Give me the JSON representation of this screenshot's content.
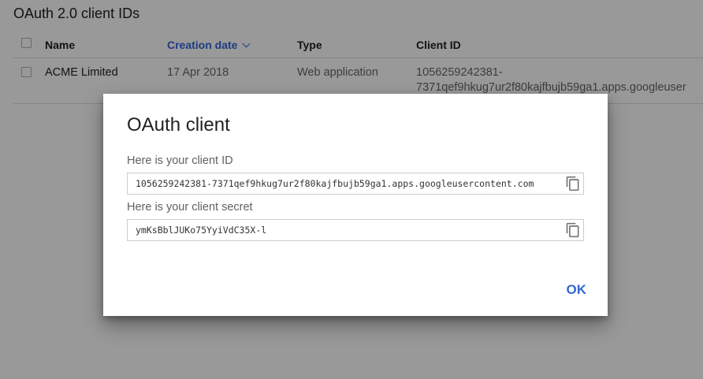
{
  "page": {
    "title": "OAuth 2.0 client IDs"
  },
  "table": {
    "columns": {
      "name": "Name",
      "creation_date": "Creation date",
      "type": "Type",
      "client_id": "Client ID"
    },
    "sort": {
      "column": "creation_date",
      "direction": "descending"
    },
    "rows": [
      {
        "name": "ACME Limited",
        "creation_date": "17 Apr 2018",
        "type": "Web application",
        "client_id_line1": "1056259242381-",
        "client_id_line2": "7371qef9hkug7ur2f80kajfbujb59ga1.apps.googleuser"
      }
    ]
  },
  "dialog": {
    "title": "OAuth client",
    "client_id_label": "Here is your client ID",
    "client_id_value": "1056259242381-7371qef9hkug7ur2f80kajfbujb59ga1.apps.googleusercontent.com",
    "client_secret_label": "Here is your client secret",
    "client_secret_value": "ymKsBblJUKo75YyiVdC35X-l",
    "ok_label": "OK"
  },
  "colors": {
    "accent": "#3367d6",
    "overlay": "rgba(0,0,0,0.40)"
  },
  "icons": {
    "copy": "copy-icon",
    "sort": "chevron-down-icon"
  }
}
